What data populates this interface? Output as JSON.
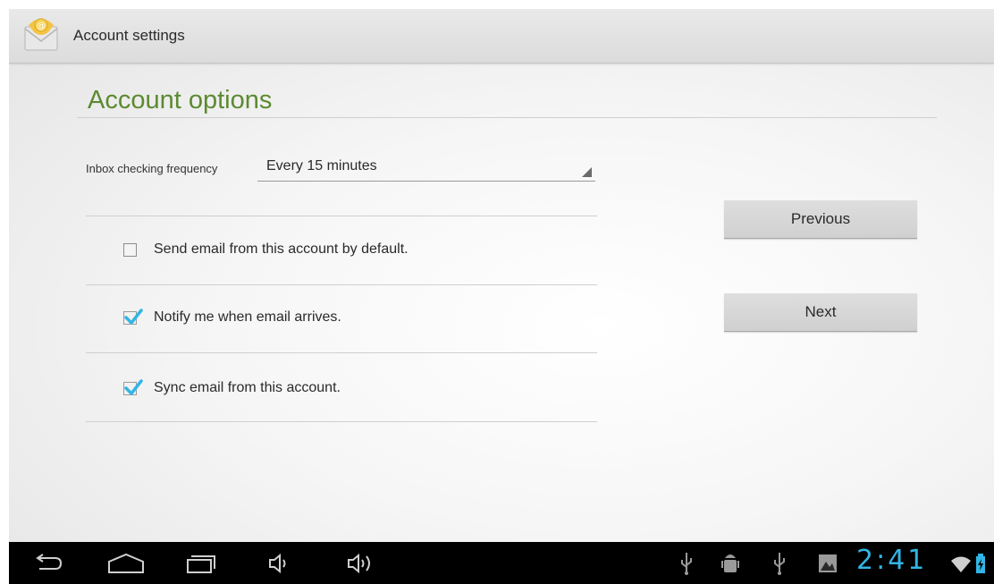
{
  "actionbar": {
    "title": "Account settings",
    "app_icon": "email-app-icon"
  },
  "section": {
    "title": "Account options"
  },
  "frequency": {
    "label": "Inbox checking frequency",
    "selected": "Every 15 minutes"
  },
  "options": [
    {
      "label": "Send email from this account by default.",
      "checked": false
    },
    {
      "label": "Notify me when email arrives.",
      "checked": true
    },
    {
      "label": "Sync email from this account.",
      "checked": true
    }
  ],
  "buttons": {
    "previous": "Previous",
    "next": "Next"
  },
  "navbar": {
    "icons": [
      "back-icon",
      "home-icon",
      "recent-apps-icon",
      "volume-down-icon",
      "volume-up-icon"
    ]
  },
  "statusbar": {
    "icons": [
      "usb-icon",
      "android-debug-icon",
      "usb-icon",
      "gallery-notification-icon",
      "wifi-icon",
      "battery-charging-icon"
    ],
    "time": "2:41"
  },
  "colors": {
    "accent": "#33b5e5",
    "section_title": "#5c8a31",
    "check": "#33b5e5"
  }
}
